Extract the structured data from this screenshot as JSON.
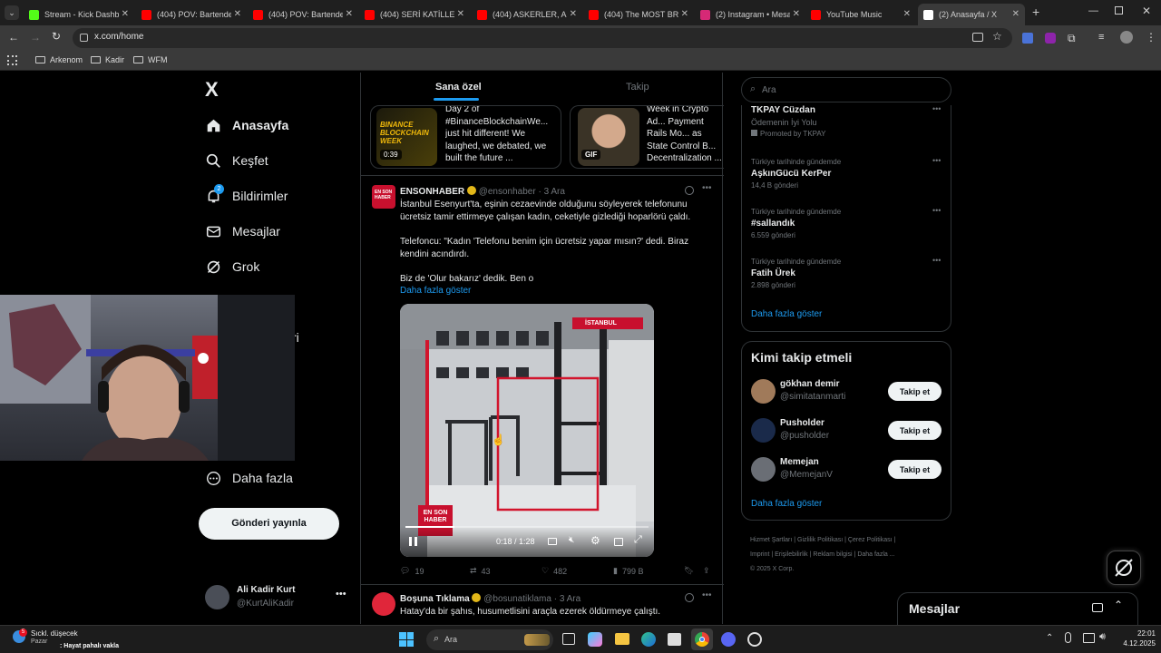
{
  "browser": {
    "tabs": [
      {
        "title": "Stream - Kick Dashbo",
        "color": "#53fc18"
      },
      {
        "title": "(404) POV: Bartender",
        "color": "#ff0000"
      },
      {
        "title": "(404) POV: Bartender",
        "color": "#ff0000"
      },
      {
        "title": "(404) SERİ KATİLLERİ",
        "color": "#ff0000"
      },
      {
        "title": "(404) ASKERLER, ASK",
        "color": "#ff0000"
      },
      {
        "title": "(404) The MOST BRU",
        "color": "#ff0000"
      },
      {
        "title": "(2) Instagram • Mesa",
        "color": "#d62976"
      },
      {
        "title": "YouTube Music",
        "color": "#ff0000"
      },
      {
        "title": "(2) Anasayfa / X",
        "color": "#ffffff"
      }
    ],
    "url": "x.com/home",
    "bookmarks": [
      "Arkenom",
      "Kadir",
      "WFM"
    ]
  },
  "nav": {
    "logo": "X",
    "items": [
      {
        "label": "Anasayfa",
        "icon": "home-icon"
      },
      {
        "label": "Keşfet",
        "icon": "search-icon"
      },
      {
        "label": "Bildirimler",
        "icon": "bell-icon"
      },
      {
        "label": "Mesajlar",
        "icon": "mail-icon"
      },
      {
        "label": "Grok",
        "icon": "grok-icon"
      }
    ],
    "notif_count": "2",
    "partial_label": "ri",
    "more": "Daha fazla",
    "post_button": "Gönderi yayınla",
    "user": {
      "name": "Ali Kadir Kurt",
      "handle": "@KurtAliKadir"
    }
  },
  "feed": {
    "tabs": [
      "Sana özel",
      "Takip"
    ],
    "cards": [
      {
        "text": "Day 2 of #BinanceBlockchainWe... just hit different! We laughed, we debated, we built the future ...",
        "badge": "0:39",
        "thumb_text": "BINANCE BLOCKCHAIN WEEK"
      },
      {
        "text": "Week in Crypto Ad... Payment Rails Mo... as State Control B... Decentralization ...",
        "badge": "GIF"
      }
    ],
    "tweet": {
      "name": "ENSONHABER",
      "avatar_text": "EN SON HABER",
      "handle": "@ensonhaber",
      "time": "3 Ara",
      "p1": "İstanbul Esenyurt'ta, eşinin cezaevinde olduğunu söyleyerek telefonunu ücretsiz tamir ettirmeye çalışan kadın, ceketiyle gizlediği hoparlörü çaldı.",
      "p2": "Telefoncu: \"Kadın 'Telefonu benim için ücretsiz yapar mısın?' dedi. Biraz kendini acındırdı.",
      "p3": "Biz de 'Olur bakarız' dedik. Ben o",
      "show_more": "Daha fazla göster",
      "video_tag": "İSTANBUL",
      "video_logo": "EN SON HABER",
      "video_time": "0:18 / 1:28",
      "replies": "19",
      "reposts": "43",
      "likes": "482",
      "views": "799 B"
    },
    "tweet2": {
      "name": "Boşuna Tıklama",
      "handle": "@bosunatiklama",
      "time": "3 Ara",
      "text": "Hatay'da bir şahıs, husumetlisini araçla ezerek öldürmeye çalıştı."
    }
  },
  "right": {
    "search_placeholder": "Ara",
    "promoted": {
      "title": "TKPAY Cüzdan",
      "sub": "Ödemenin İyi Yolu",
      "label": "Promoted by TKPAY"
    },
    "trends": [
      {
        "context": "Türkiye tarihinde gündemde",
        "name": "AşkınGücü KerPer",
        "count": "14,4 B gönderi"
      },
      {
        "context": "Türkiye tarihinde gündemde",
        "name": "#sallandık",
        "count": "6.559 gönderi"
      },
      {
        "context": "Türkiye tarihinde gündemde",
        "name": "Fatih Ürek",
        "count": "2.898 gönderi"
      }
    ],
    "trends_more": "Daha fazla göster",
    "who_title": "Kimi takip etmeli",
    "follow": [
      {
        "name": "gökhan demir",
        "handle": "@simitatanmarti",
        "btn": "Takip et"
      },
      {
        "name": "Pusholder",
        "handle": "@pusholder",
        "btn": "Takip et"
      },
      {
        "name": "Memejan",
        "handle": "@MemejanV",
        "btn": "Takip et"
      }
    ],
    "who_more": "Daha fazla göster",
    "footer": [
      "Hizmet Şartları",
      "Gizlilik Politikası",
      "Çerez Politikası",
      "Imprint",
      "Erişilebilirlik",
      "Reklam bilgisi",
      "Daha fazla ..."
    ],
    "copyright": "© 2025 X Corp.",
    "messages": "Mesajlar"
  },
  "taskbar": {
    "weather_temp": "5",
    "weather_title": "Sıckl. düşecek",
    "weather_sub": "Pazar",
    "news": ": Hayat pahalı vakla",
    "search": "Ara",
    "time": "22:01",
    "date": "4.12.2025"
  }
}
